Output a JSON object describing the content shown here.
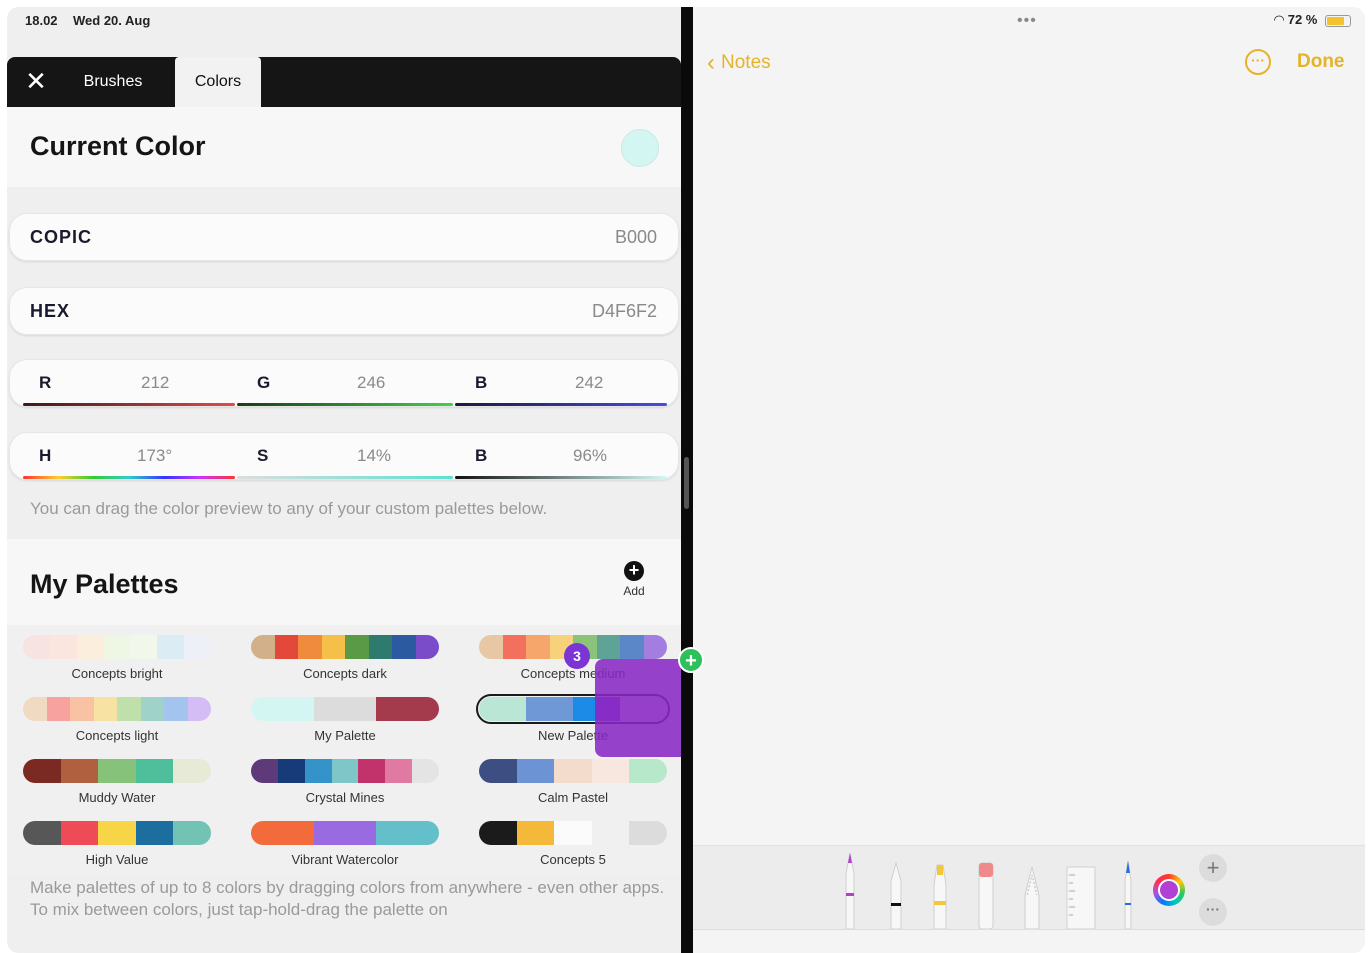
{
  "status": {
    "time": "18.02",
    "date": "Wed 20. Aug",
    "battery": "72 %"
  },
  "tabs": {
    "brushes": "Brushes",
    "colors": "Colors"
  },
  "current_color": {
    "title": "Current Color",
    "swatch_color": "#D4F6F2"
  },
  "copic": {
    "label": "COPIC",
    "value": "B000"
  },
  "hex": {
    "label": "HEX",
    "value": "D4F6F2"
  },
  "rgb": {
    "r_label": "R",
    "r_value": "212",
    "g_label": "G",
    "g_value": "246",
    "b_label": "B",
    "b_value": "242"
  },
  "hsb": {
    "h_label": "H",
    "h_value": "173°",
    "s_label": "S",
    "s_value": "14%",
    "b_label": "B",
    "b_value": "96%"
  },
  "hint": "You can drag the color preview to any of your custom palettes below.",
  "palettes": {
    "title": "My Palettes",
    "add_label": "Add",
    "items": [
      {
        "name": "Concepts bright",
        "colors": [
          "#f7e3e1",
          "#fbe6df",
          "#fbeedd",
          "#eef6e4",
          "#f2f7ec",
          "#dcecf4",
          "#eef0f8"
        ]
      },
      {
        "name": "Concepts dark",
        "colors": [
          "#d2b08a",
          "#e2493b",
          "#f08a3c",
          "#f4c04a",
          "#5a9a47",
          "#2e7a6f",
          "#2c5aa0",
          "#7b4cc9"
        ]
      },
      {
        "name": "Concepts medium",
        "colors": [
          "#e8c7a4",
          "#f3705e",
          "#f6a66b",
          "#f7d27a",
          "#8cc37a",
          "#5ea396",
          "#5b86c7",
          "#a37de0"
        ]
      },
      {
        "name": "Concepts light",
        "colors": [
          "#f0dbc2",
          "#f8a2a0",
          "#f9c3a3",
          "#f8e2a3",
          "#bfe0aa",
          "#9fd2c8",
          "#a3c4ef",
          "#d4bdf5"
        ]
      },
      {
        "name": "My Palette",
        "colors": [
          "#d4f6f2",
          "#d4f6f2",
          "#dcdcdc",
          "#dcdcdc",
          "#a33b4c",
          "#a33b4c"
        ]
      },
      {
        "name": "New Palette",
        "colors": [
          "#b9e6d5",
          "#b9e6d5",
          "#6e98d6",
          "#6e98d6",
          "#1c8be8",
          "#7e48d9",
          "#ede3f7",
          "#ede3f7"
        ]
      },
      {
        "name": "Muddy Water",
        "colors": [
          "#7a2a22",
          "#b0603e",
          "#86c27a",
          "#4fbf9b",
          "#e7ead6"
        ]
      },
      {
        "name": "Crystal Mines",
        "colors": [
          "#5f3a7a",
          "#173a78",
          "#3493c8",
          "#7ec6c8",
          "#c2336b",
          "#e07aa3",
          "#e4e4e4"
        ]
      },
      {
        "name": "Calm Pastel",
        "colors": [
          "#3d4f82",
          "#6c93d4",
          "#f3dccc",
          "#f7e7de",
          "#b6e8c9"
        ]
      },
      {
        "name": "High Value",
        "colors": [
          "#575757",
          "#ef4b57",
          "#f8d447",
          "#1b6e9e",
          "#73c3b4"
        ]
      },
      {
        "name": "Vibrant Watercolor",
        "colors": [
          "#f36b3b",
          "#9a6ae0",
          "#63bfc9"
        ]
      },
      {
        "name": "Concepts 5",
        "colors": [
          "#1b1b1b",
          "#f5b93a",
          "#fbfbfb",
          "#f0f0f0",
          "#dcdcdc"
        ]
      }
    ]
  },
  "drag_badge_count": "3",
  "footer_hint": "Make palettes of up to 8 colors by dragging colors from anywhere - even other apps. To mix between colors, just tap-hold-drag the palette on",
  "notes": {
    "back_label": "Notes",
    "done_label": "Done",
    "accent": "#e5b32a"
  }
}
